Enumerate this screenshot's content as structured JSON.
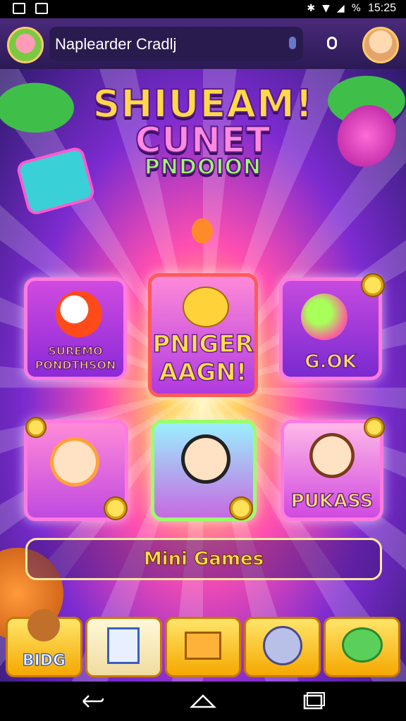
{
  "status_bar": {
    "time": "15:25",
    "battery": "%"
  },
  "header": {
    "username": "Naplearder Cradlj"
  },
  "title": {
    "line1": "SHIUEAM!",
    "line2": "CUNET",
    "line3": "PNDOION"
  },
  "cards": [
    {
      "label_line1": "SUREMO",
      "label_line2": "PONDTHSON"
    },
    {
      "label_line1": "PNIGER",
      "label_line2": "AAGN!"
    },
    {
      "label": "G.OK"
    },
    {
      "label": ""
    },
    {
      "label": ""
    },
    {
      "label": "PUKASS"
    }
  ],
  "mini_games": {
    "label": "Mini Games"
  },
  "tabs": [
    {
      "label": "BIDG",
      "icon": "bear-icon"
    },
    {
      "label": "",
      "icon": "clipboard-icon"
    },
    {
      "label": "",
      "icon": "chest-icon"
    },
    {
      "label": "",
      "icon": "ghost-icon"
    },
    {
      "label": "",
      "icon": "frog-icon"
    }
  ],
  "colors": {
    "accent": "#ff7ae0",
    "gold": "#ffd84a",
    "purple": "#5a1a86"
  }
}
